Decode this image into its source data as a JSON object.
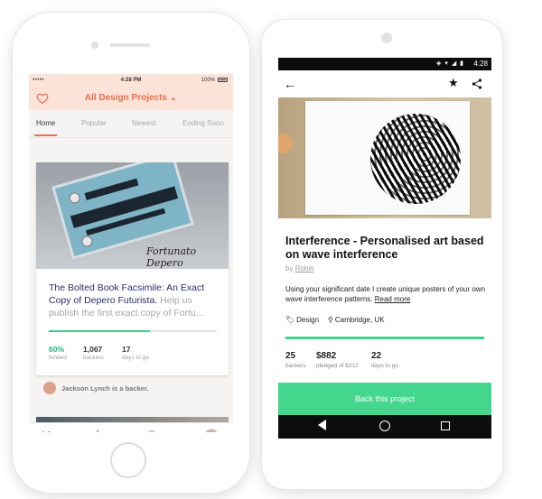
{
  "ios": {
    "status": {
      "signal": "•••••",
      "time": "4:28 PM",
      "battery": "100%"
    },
    "header": {
      "title": "All Design Projects ⌄"
    },
    "tabs": [
      "Home",
      "Popular",
      "Newest",
      "Ending Soon"
    ],
    "card": {
      "image_text": "Fortunato Depero",
      "title_bold": "The Bolted Book Facsimile: An Exact Copy of Depero Futurista.",
      "title_rest": " Help us publish the first exact copy of Fortu...",
      "progress": 0.6,
      "stats": [
        {
          "value": "60%",
          "label": "funded"
        },
        {
          "value": "1,067",
          "label": "backers"
        },
        {
          "value": "17",
          "label": "days to go"
        }
      ]
    },
    "backer_note": "Jackson Lynch is a backer."
  },
  "android": {
    "status": {
      "icons": "◈ ▾ ◢ ▮",
      "time": "4:28"
    },
    "project": {
      "title": "Interference - Personalised art based on wave interference",
      "by": "by",
      "author": "Robin",
      "description": "Using your significant date I create unique posters of your own wave interference patterns.",
      "read_more": "Read more",
      "category": "Design",
      "location": "Cambridge, UK",
      "stats": [
        {
          "value": "25",
          "label": "backers"
        },
        {
          "value": "$882",
          "label": "pledged of $312"
        },
        {
          "value": "22",
          "label": "days to go"
        }
      ],
      "cta": "Back this project"
    }
  },
  "colors": {
    "accent": "#f06b4f",
    "green": "#44d68d",
    "link": "#2b2b6b"
  }
}
